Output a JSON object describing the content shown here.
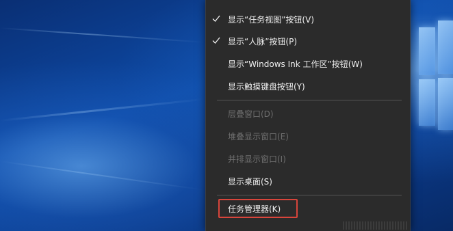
{
  "menu": {
    "items": [
      {
        "label": "显示“任务视图”按钮(V)",
        "checked": true,
        "enabled": true
      },
      {
        "label": "显示“人脉”按钮(P)",
        "checked": true,
        "enabled": true
      },
      {
        "label": "显示“Windows Ink 工作区”按钮(W)",
        "checked": false,
        "enabled": true
      },
      {
        "label": "显示触摸键盘按钮(Y)",
        "checked": false,
        "enabled": true
      },
      {
        "label": "层叠窗口(D)",
        "checked": false,
        "enabled": false
      },
      {
        "label": "堆叠显示窗口(E)",
        "checked": false,
        "enabled": false
      },
      {
        "label": "并排显示窗口(I)",
        "checked": false,
        "enabled": false
      },
      {
        "label": "显示桌面(S)",
        "checked": false,
        "enabled": true
      },
      {
        "label": "任务管理器(K)",
        "checked": false,
        "enabled": true,
        "highlighted": true
      }
    ]
  },
  "colors": {
    "menu_bg": "#2b2b2b",
    "menu_text": "#f0f0f0",
    "disabled_text": "#6e6e6e",
    "separator": "#555555",
    "highlight_border": "#d9453b"
  },
  "icons": {
    "check": "check-icon",
    "windows_logo": "windows-logo-icon"
  }
}
